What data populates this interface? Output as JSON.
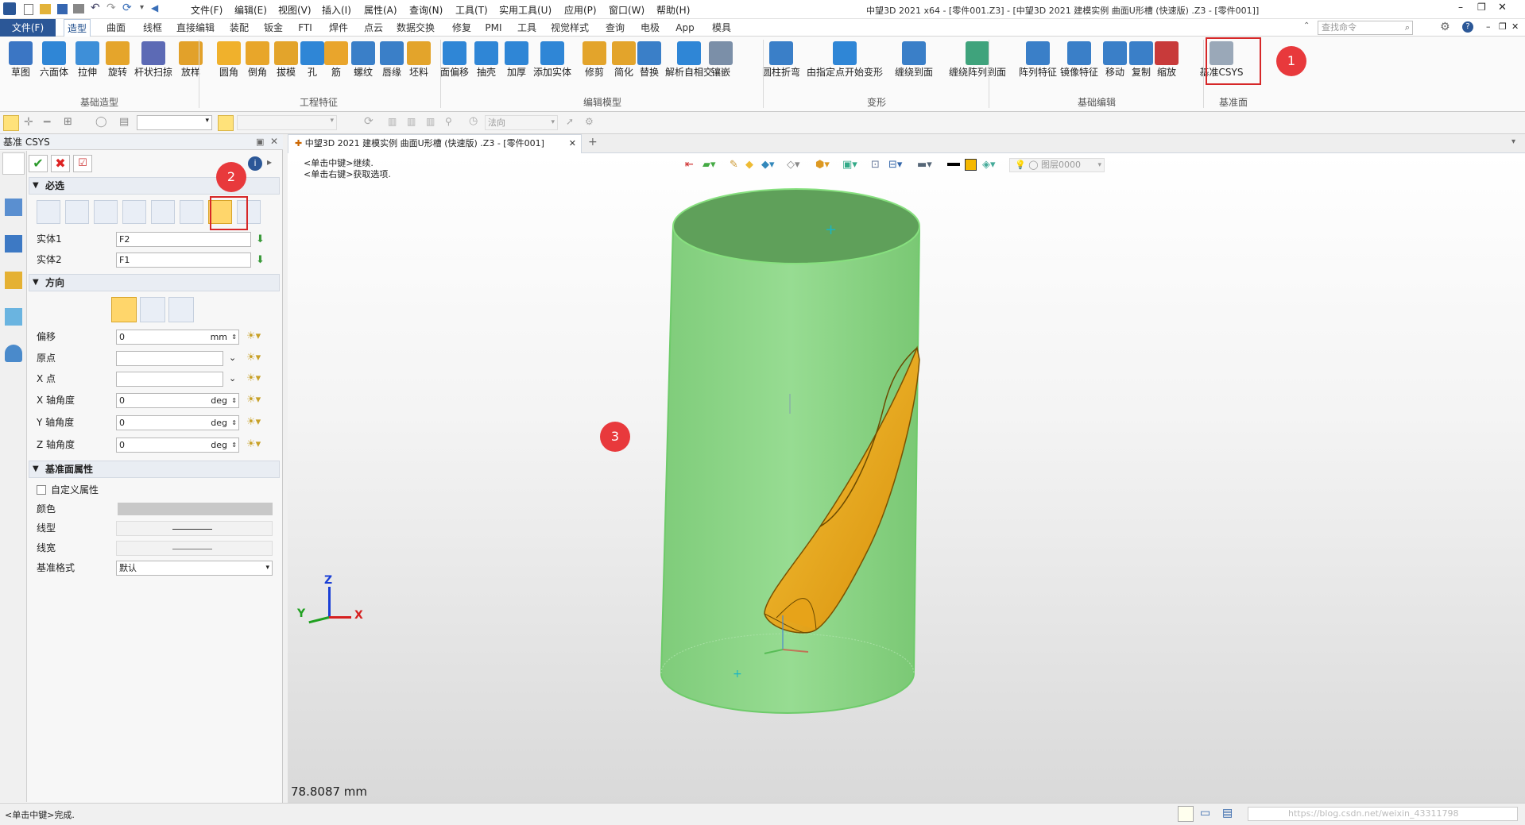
{
  "titlebar": {
    "title": "中望3D 2021 x64 - [零件001.Z3] - [中望3D 2021 建模实例 曲面U形槽 (快速版) .Z3 - [零件001]]",
    "menus": [
      "文件(F)",
      "编辑(E)",
      "视图(V)",
      "插入(I)",
      "属性(A)",
      "查询(N)",
      "工具(T)",
      "实用工具(U)",
      "应用(P)",
      "窗口(W)",
      "帮助(H)"
    ]
  },
  "menubar": {
    "file_tab": "文件(F)",
    "tabs": [
      "造型",
      "曲面",
      "线框",
      "直接编辑",
      "装配",
      "钣金",
      "FTI",
      "焊件",
      "点云",
      "数据交换",
      "修复",
      "PMI",
      "工具",
      "视觉样式",
      "查询",
      "电极",
      "App",
      "模具"
    ],
    "active_tab": "造型",
    "search_placeholder": "查找命令"
  },
  "ribbon": {
    "buttons": [
      "草图",
      "六面体",
      "拉伸",
      "旋转",
      "杆状扫掠",
      "放样",
      "圆角",
      "倒角",
      "拔模",
      "孔",
      "筋",
      "螺纹",
      "唇缘",
      "坯料",
      "面偏移",
      "抽壳",
      "加厚",
      "添加实体",
      "修剪",
      "简化",
      "替换",
      "解析自相交",
      "镶嵌",
      "圆柱折弯",
      "由指定点开始变形",
      "缠绕到面",
      "缠绕阵列到面",
      "阵列特征",
      "镜像特征",
      "移动",
      "复制",
      "缩放",
      "基准CSYS"
    ],
    "groups": [
      "基础造型",
      "工程特征",
      "编辑模型",
      "变形",
      "基础编辑",
      "基准面"
    ]
  },
  "toolbar2": {
    "dropdown2": "法向"
  },
  "panel": {
    "title": "基准 CSYS",
    "sect_required": "必选",
    "entity1_label": "实体1",
    "entity1_value": "F2",
    "entity2_label": "实体2",
    "entity2_value": "F1",
    "sect_direction": "方向",
    "offset_label": "偏移",
    "offset_value": "0",
    "offset_unit": "mm",
    "origin_label": "原点",
    "xpoint_label": "X 点",
    "xangle_label": "X 轴角度",
    "xangle_value": "0",
    "yangle_label": "Y 轴角度",
    "yangle_value": "0",
    "zangle_label": "Z 轴角度",
    "zangle_value": "0",
    "angle_unit": "deg",
    "sect_plane": "基准面属性",
    "custom_label": "自定义属性",
    "color_label": "颜色",
    "linetype_label": "线型",
    "linewidth_label": "线宽",
    "format_label": "基准格式",
    "format_value": "默认"
  },
  "doc": {
    "tab_label": "中望3D 2021 建模实例 曲面U形槽 (快速版) .Z3 - [零件001]",
    "hint1": "<单击中键>继续.",
    "hint2": "<单击右键>获取选项.",
    "layer_label": "图层0000",
    "measure": "78.8087 mm"
  },
  "axes": {
    "z": "Z",
    "y": "Y",
    "x": "X"
  },
  "badges": [
    "1",
    "2",
    "3"
  ],
  "status": {
    "left": "<单击中键>完成.",
    "watermark": "https://blog.csdn.net/weixin_43311798"
  },
  "colors": {
    "cylinder": "#8fd68a",
    "slot": "#f0b31c",
    "accent": "#2b5797",
    "badge": "#e8393c"
  }
}
